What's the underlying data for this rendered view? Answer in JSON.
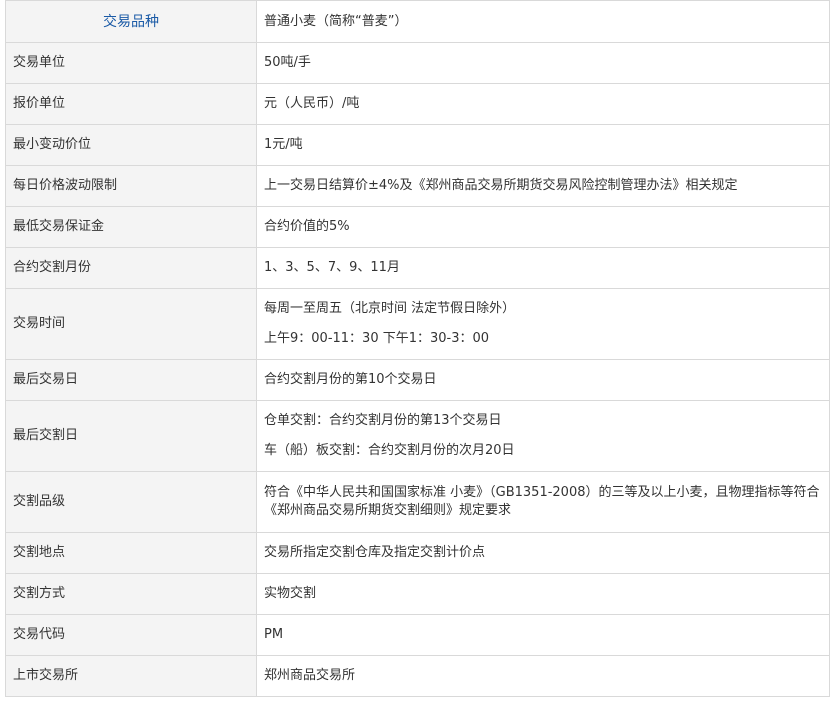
{
  "table": {
    "rows": [
      {
        "key": "交易品种",
        "values": [
          "普通小麦（简称“普麦”）"
        ]
      },
      {
        "key": "交易单位",
        "values": [
          "50吨/手"
        ]
      },
      {
        "key": "报价单位",
        "values": [
          "元（人民币）/吨"
        ]
      },
      {
        "key": "最小变动价位",
        "values": [
          "1元/吨"
        ]
      },
      {
        "key": "每日价格波动限制",
        "values": [
          "上一交易日结算价±4%及《郑州商品交易所期货交易风险控制管理办法》相关规定"
        ]
      },
      {
        "key": "最低交易保证金",
        "values": [
          "合约价值的5%"
        ]
      },
      {
        "key": "合约交割月份",
        "values": [
          "1、3、5、7、9、11月"
        ]
      },
      {
        "key": "交易时间",
        "values": [
          "每周一至周五（北京时间 法定节假日除外）",
          "上午9：00-11：30 下午1：30-3：00"
        ]
      },
      {
        "key": "最后交易日",
        "values": [
          "合约交割月份的第10个交易日"
        ]
      },
      {
        "key": "最后交割日",
        "values": [
          "仓单交割：合约交割月份的第13个交易日",
          "车（船）板交割：合约交割月份的次月20日"
        ]
      },
      {
        "key": "交割品级",
        "values": [
          "符合《中华人民共和国国家标准 小麦》（GB1351-2008）的三等及以上小麦，且物理指标等符合《郑州商品交易所期货交割细则》规定要求"
        ]
      },
      {
        "key": "交割地点",
        "values": [
          "交易所指定交割仓库及指定交割计价点"
        ]
      },
      {
        "key": "交割方式",
        "values": [
          "实物交割"
        ]
      },
      {
        "key": "交易代码",
        "values": [
          "PM"
        ]
      },
      {
        "key": "上市交易所",
        "values": [
          "郑州商品交易所"
        ]
      }
    ]
  }
}
